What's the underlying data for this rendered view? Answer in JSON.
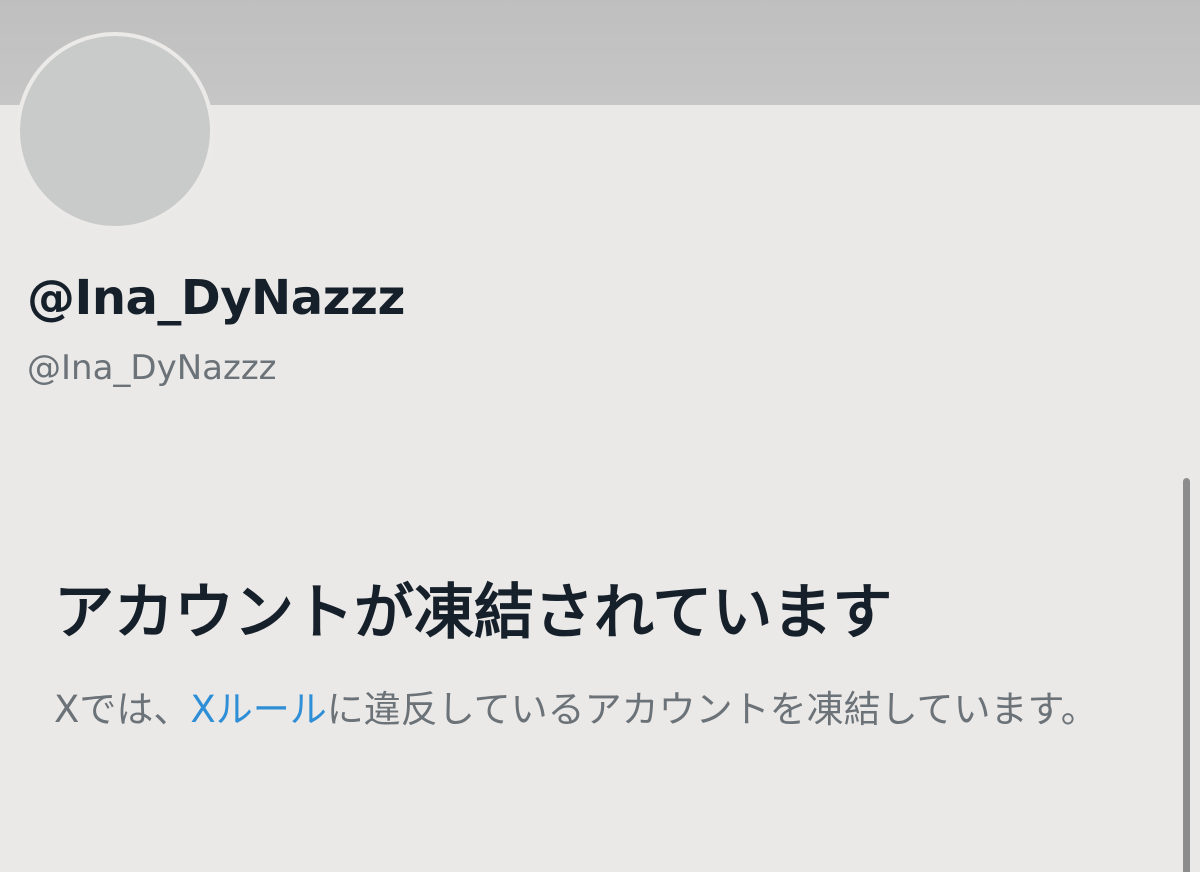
{
  "profile": {
    "display_name": "@Ina_DyNazzz",
    "handle": "@Ina_DyNazzz"
  },
  "notice": {
    "title": "アカウントが凍結されています",
    "desc_before": "Xでは、",
    "rules_link": "Xルール",
    "desc_after": "に違反しているアカウントを凍結しています。"
  },
  "colors": {
    "background": "#ebe9e7",
    "banner": "#c2c2c2",
    "text_primary": "#16202b",
    "text_secondary": "#6b7278",
    "link": "#2f8fd6"
  }
}
